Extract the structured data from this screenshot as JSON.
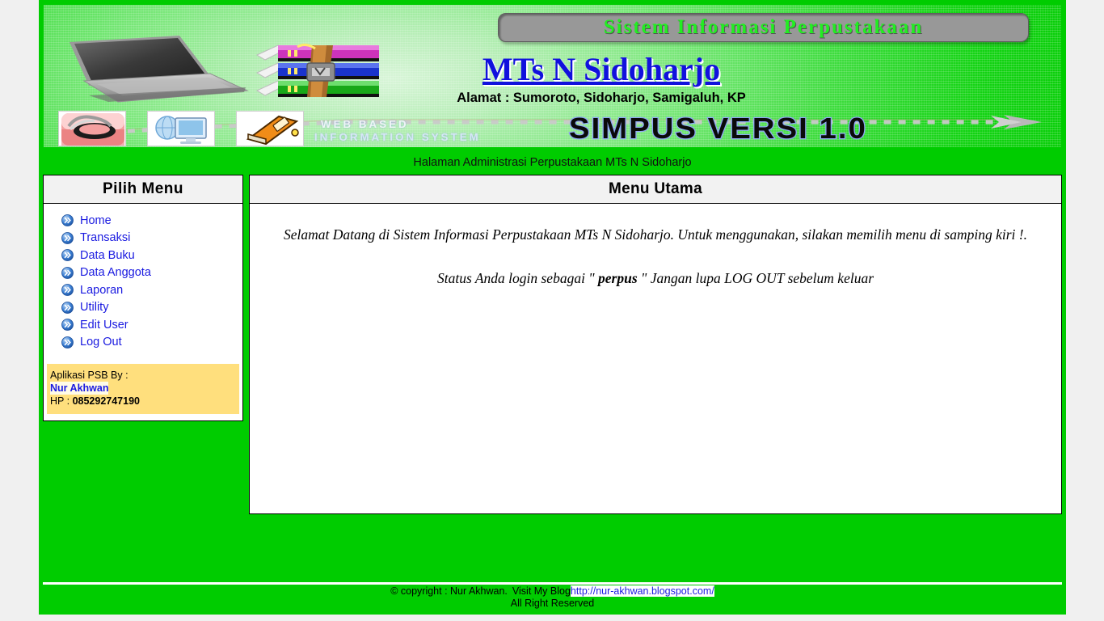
{
  "header": {
    "badge_text": "Sistem Informasi Perpustakaan",
    "school_title": "MTs N Sidoharjo",
    "school_address": "Alamat : Sumoroto, Sidoharjo, Samigaluh, KP",
    "webbased_line1": "WEB BASED",
    "webbased_line2": "INFORMATION SYSTEM",
    "simpus_text": "SIMPUS VERSI 1.0",
    "icons": {
      "laptop": "laptop-icon",
      "books": "book-stack-icon",
      "browser": "internet-explorer-icon",
      "computer": "computer-network-icon",
      "book": "orange-book-icon"
    }
  },
  "admin_strip": {
    "text": "Halaman Administrasi Perpustakaan MTs N Sidoharjo"
  },
  "sidebar": {
    "header": "Pilih Menu",
    "items": [
      {
        "label": "Home"
      },
      {
        "label": "Transaksi"
      },
      {
        "label": "Data Buku"
      },
      {
        "label": "Data Anggota"
      },
      {
        "label": "Laporan"
      },
      {
        "label": "Utility"
      },
      {
        "label": "Edit User"
      },
      {
        "label": "Log Out"
      }
    ],
    "credit": {
      "line1": "Aplikasi PSB By :",
      "name": "Nur Akhwan",
      "hp_label": "HP : ",
      "hp_number": "085292747190"
    }
  },
  "main": {
    "header": "Menu Utama",
    "welcome": "Selamat Datang di Sistem Informasi Perpustakaan MTs N Sidoharjo. Untuk menggunakan, silakan memilih menu di samping kiri !.",
    "status_prefix": "Status Anda login sebagai \" ",
    "status_user": "perpus",
    "status_suffix": " \" Jangan lupa LOG OUT sebelum keluar"
  },
  "footer": {
    "copyright": "© copyright : Nur Akhwan.",
    "visit_label": "Visit My Blog",
    "blog_url": "http://nur-akhwan.blogspot.com/",
    "rights": "All Right Reserved"
  },
  "colors": {
    "page_green": "#00cc00",
    "link_blue": "#1a1ae0",
    "credit_yellow": "#ffdf7d",
    "badge_gray": "#989898",
    "badge_text_green": "#22ee22"
  }
}
